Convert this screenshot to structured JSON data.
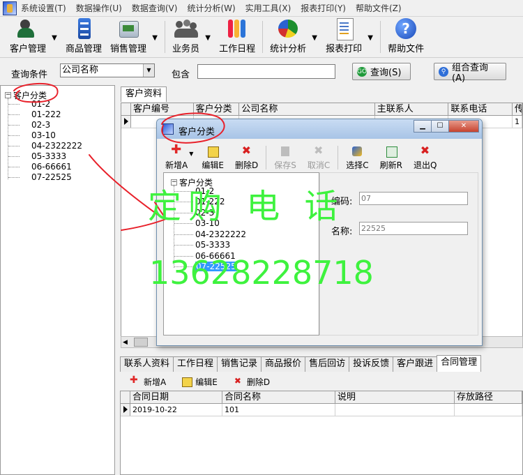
{
  "menu": [
    "系统设置(T)",
    "数据操作(U)",
    "数据查询(V)",
    "统计分析(W)",
    "实用工具(X)",
    "报表打印(Y)",
    "帮助文件(Z)"
  ],
  "toolbar": {
    "customer": "客户管理",
    "product": "商品管理",
    "sales": "销售管理",
    "staff": "业务员",
    "schedule": "工作日程",
    "stats": "统计分析",
    "report": "报表打印",
    "help": "帮助文件"
  },
  "search": {
    "condition_label": "查询条件",
    "condition_value": "公司名称",
    "contains_label": "包含",
    "query_label": "查询(S)",
    "combo_label": "组合查询(A)"
  },
  "tree": {
    "root": "客户分类",
    "items": [
      "01-2",
      "01-222",
      "02-3",
      "03-10",
      "04-2322222",
      "05-3333",
      "06-66661",
      "07-22525"
    ]
  },
  "customer_tab": "客户资料",
  "customer_grid": {
    "headers": [
      "客户编号",
      "客户分类",
      "公司名称",
      "主联系人",
      "联系电话",
      "传"
    ],
    "row1_last": "1"
  },
  "bottom_tabs": [
    "联系人资料",
    "工作日程",
    "销售记录",
    "商品报价",
    "售后回访",
    "投诉反馈",
    "客户跟进",
    "合同管理"
  ],
  "bottom_toolbar": {
    "add": "新增A",
    "edit": "编辑E",
    "delete": "删除D"
  },
  "contract_grid": {
    "headers": [
      "合同日期",
      "合同名称",
      "说明",
      "存放路径"
    ],
    "rows": [
      [
        "2019-10-22",
        "101",
        "",
        ""
      ]
    ]
  },
  "dialog": {
    "title": "客户分类",
    "toolbar": {
      "add": "新增A",
      "edit": "编辑E",
      "delete": "删除D",
      "save": "保存S",
      "cancel": "取消C",
      "select": "选择C",
      "refresh": "刷新R",
      "exit": "退出Q"
    },
    "tree_root": "客户分类",
    "tree_items": [
      "01-2",
      "01-222",
      "02-3",
      "03-10",
      "04-2322222",
      "05-3333",
      "06-66661",
      "07-22525"
    ],
    "code_label": "编码:",
    "code_value": "07",
    "name_label": "名称:",
    "name_value": "22525"
  },
  "watermark": {
    "line1": "定购 电 话",
    "line2": "13628228718"
  },
  "colors": {
    "annotation": "#e8202a",
    "watermark": "#3ef23e",
    "selection": "#3399ff"
  }
}
